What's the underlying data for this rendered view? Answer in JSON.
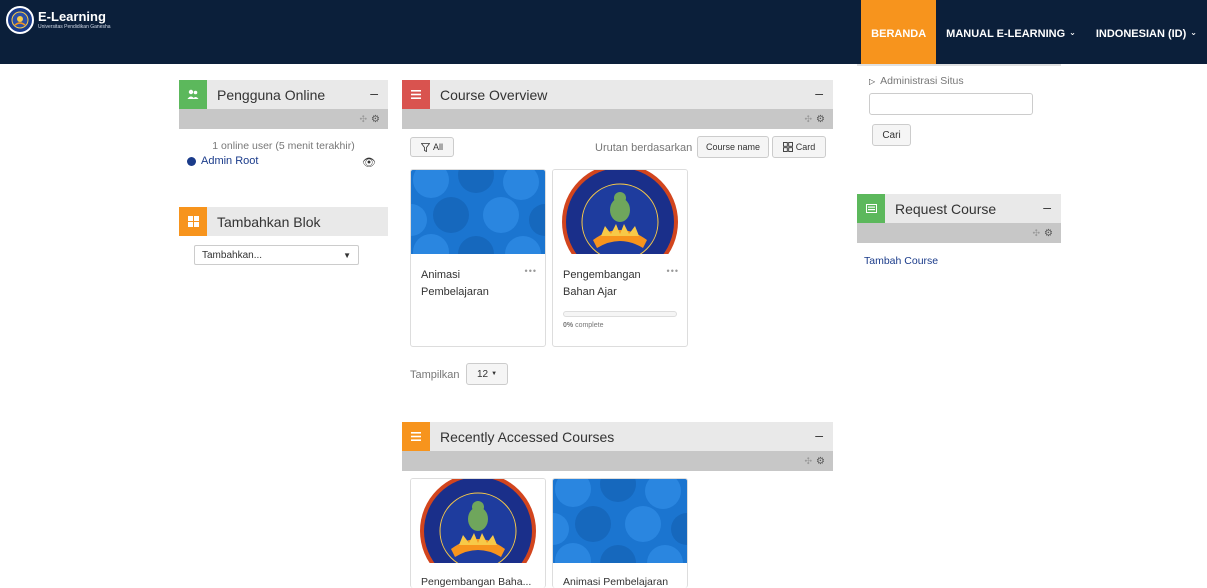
{
  "brand": {
    "title": "E-Learning",
    "subtitle": "Universitas Pendidikan Ganesha"
  },
  "nav": {
    "home": "BERANDA",
    "manual": "MANUAL E-LEARNING",
    "language": "INDONESIAN (ID)"
  },
  "online_block": {
    "title": "Pengguna Online",
    "summary": "1 online user (5 menit terakhir)",
    "user": "Admin Root"
  },
  "add_block": {
    "title": "Tambahkan Blok",
    "select_value": "Tambahkan..."
  },
  "overview": {
    "title": "Course Overview",
    "filter_label": "All",
    "sort_label": "Urutan berdasarkan",
    "sort_button": "Course name",
    "view_button": "Card",
    "courses": [
      {
        "name_line1": "Animasi",
        "name_line2": "Pembelajaran"
      },
      {
        "name_line1": "Pengembangan",
        "name_line2": "Bahan Ajar",
        "progress_percent": 0,
        "progress_value": "0%",
        "progress_suffix": " complete"
      }
    ],
    "show_label": "Tampilkan",
    "show_value": "12"
  },
  "recent": {
    "title": "Recently Accessed Courses",
    "courses": [
      {
        "name": "Pengembangan Baha..."
      },
      {
        "name": "Animasi Pembelajaran"
      }
    ]
  },
  "admin": {
    "link": "Administrasi Situs",
    "search_button": "Cari"
  },
  "request_block": {
    "title": "Request Course",
    "link": "Tambah Course"
  },
  "colors": {
    "navbar": "#0b1f3a",
    "accent_orange": "#f7941d",
    "icon_green": "#5cb85c",
    "icon_red": "#d9534f",
    "card_blue": "#1b75d0"
  }
}
